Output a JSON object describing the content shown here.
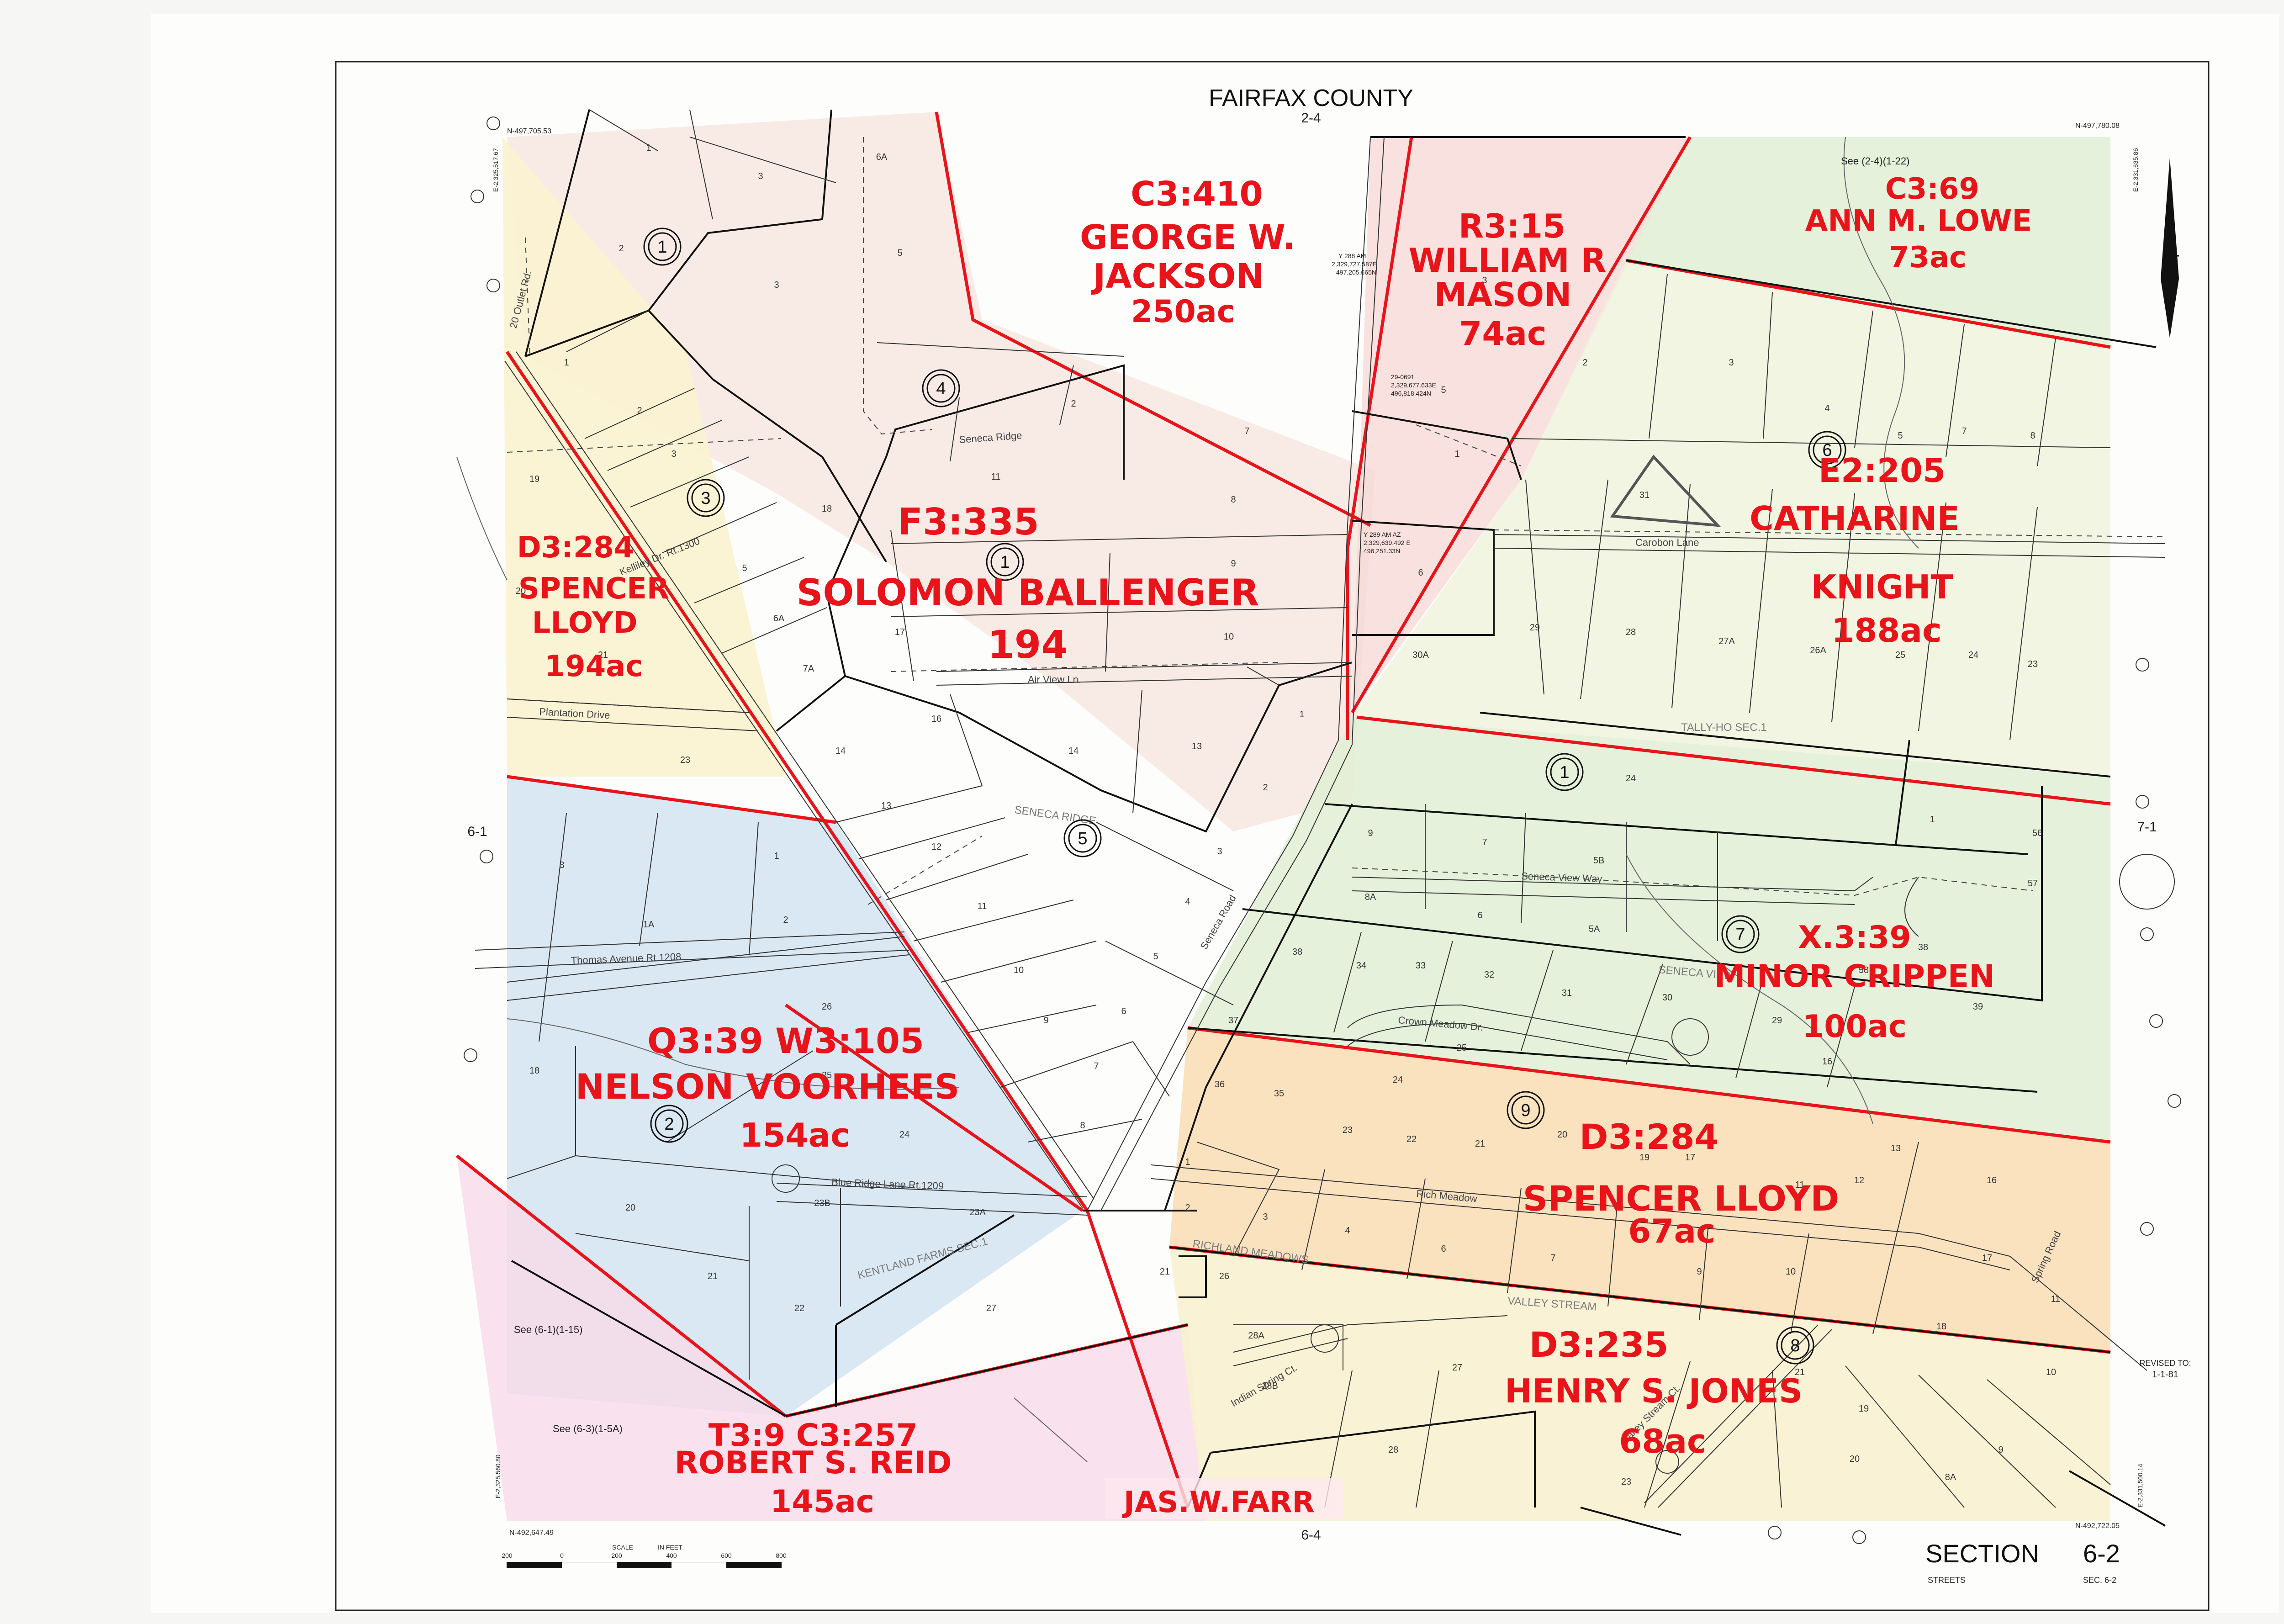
{
  "header": {
    "county": "FAIRFAX COUNTY",
    "sheet_top": "2-4",
    "sheet_bottom": "6-4",
    "sheet_left": "6-1",
    "sheet_right": "7-1"
  },
  "coords": {
    "nw_north": "N-497,705.53",
    "ne_north": "N-497,780.08",
    "nw_east": "E-2,325,517.67",
    "ne_east": "E-2,331,635.86",
    "sw_east": "E-2,325,560.80",
    "se_east": "E-2,331,500.14",
    "sw_north": "N-492,647.49",
    "se_north": "N-492,722.05",
    "survey_point_1": [
      "Y 288 AM",
      "2,329,727.587E",
      "497,205.665N"
    ],
    "survey_point_2": [
      "29-0691",
      "2,329,677.633E",
      "496,818.424N"
    ],
    "survey_point_3": [
      "Y 289 AM AZ",
      "2,329,639.492 E",
      "496,251.33N"
    ]
  },
  "title_block": {
    "section": "SECTION",
    "number": "6-2",
    "streets": "STREETS",
    "sec_ref": "SEC. 6-2"
  },
  "revised": {
    "label": "REVISED TO:",
    "date": "1-1-81"
  },
  "scale": {
    "label": "SCALE",
    "unit": "IN FEET",
    "ticks": [
      "200",
      "0",
      "200",
      "400",
      "600",
      "800"
    ]
  },
  "see_refs": {
    "ne": "See (2-4)(1-22)",
    "sw1": "See (6-1)(1-15)",
    "sw2": "See (6-3)(1-5A)"
  },
  "owners": [
    {
      "ref": "C3:410",
      "name1": "GEORGE W.",
      "name2": "JACKSON",
      "acres": "250ac"
    },
    {
      "ref": "R3:15",
      "name1": "WILLIAM R",
      "name2": "MASON",
      "acres": "74ac"
    },
    {
      "ref": "C3:69",
      "name1": "ANN M. LOWE",
      "acres": "73ac"
    },
    {
      "ref": "F3:335",
      "name1": "SOLOMON BALLENGER",
      "acres": "194"
    },
    {
      "ref": "D3:284",
      "name1": "SPENCER",
      "name2": "LLOYD",
      "acres": "194ac"
    },
    {
      "ref": "E2:205",
      "name1": "CATHARINE",
      "name2": "KNIGHT",
      "acres": "188ac"
    },
    {
      "ref": "X.3:39",
      "name1": "MINOR CRIPPEN",
      "acres": "100ac"
    },
    {
      "ref": "Q3:39 W3:105",
      "name1": "NELSON VOORHEES",
      "acres": "154ac"
    },
    {
      "ref": "D3:284",
      "name1": "SPENCER LLOYD",
      "acres": "67ac"
    },
    {
      "ref": "D3:235",
      "name1": "HENRY S. JONES",
      "acres": "68ac"
    },
    {
      "ref": "T3:9 C3:257",
      "name1": "ROBERT S. REID",
      "acres": "145ac"
    },
    {
      "ref": "",
      "name1": "JAS.W.FARR",
      "acres": ""
    }
  ],
  "streets": [
    "Seneca Ridge",
    "Air View Ln.",
    "Plantation Drive",
    "Thomas Avenue Rt.1208",
    "Blue Ridge Lane Rt.1209",
    "Seneca View Way",
    "Crown Meadow Dr.",
    "Rich Meadow",
    "Carobon Lane",
    "Valley Stream Ct.",
    "Indian Spring Ct.",
    "Seneca Road",
    "Kelliley Dr. Rt.1300",
    "20 Outlet Rd.",
    "Spring Road"
  ],
  "subdivisions": [
    "SENECA RIDGE",
    "KENTLAND FARMS SEC.1",
    "TALLY-HO SEC.1",
    "SENECA VIEW",
    "RICHLAND MEADOWS",
    "VALLEY STREAM"
  ],
  "blocks": [
    "1",
    "2",
    "3",
    "4",
    "5",
    "6",
    "7",
    "8",
    "9",
    "1",
    "1",
    "2"
  ],
  "colors": {
    "red_ink": "#e8141a",
    "block_line": "#111111",
    "blue_area": "#d6e6f2",
    "green_area": "#e2f0d6",
    "yellow_area": "#f8f1cf",
    "orange_area": "#f9dfb8",
    "pink_area": "#f7d9e8",
    "beige_area": "#f6e6de"
  }
}
